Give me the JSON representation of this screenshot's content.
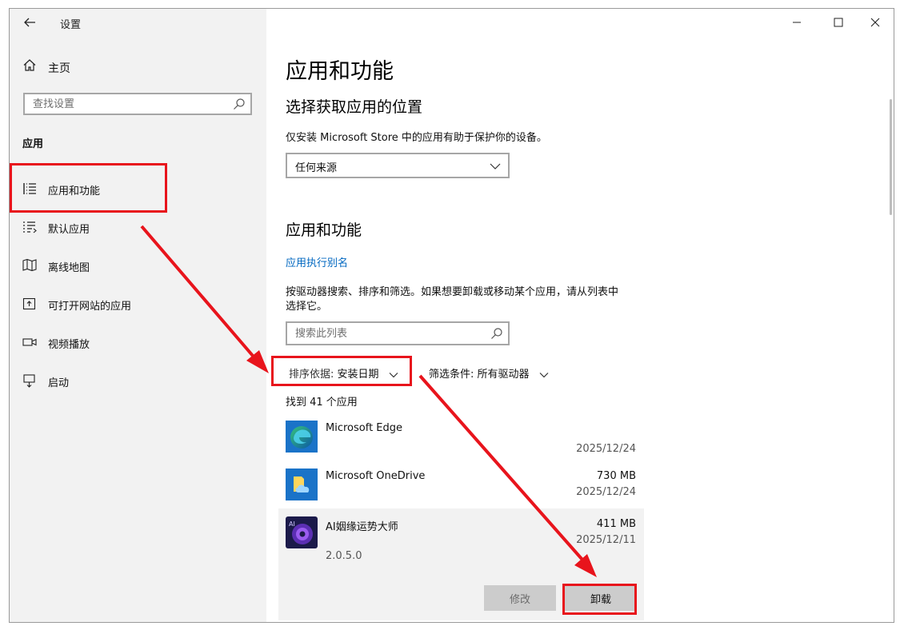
{
  "window": {
    "title": "设置",
    "back_icon": "back-arrow-icon",
    "controls": [
      "minimize-icon",
      "maximize-icon",
      "close-icon"
    ]
  },
  "sidebar": {
    "home_label": "主页",
    "search_placeholder": "查找设置",
    "section_title": "应用",
    "items": [
      {
        "label": "应用和功能",
        "icon": "apps-list-icon",
        "selected": true
      },
      {
        "label": "默认应用",
        "icon": "default-apps-icon"
      },
      {
        "label": "离线地图",
        "icon": "map-icon"
      },
      {
        "label": "可打开网站的应用",
        "icon": "open-website-icon"
      },
      {
        "label": "视频播放",
        "icon": "video-icon"
      },
      {
        "label": "启动",
        "icon": "startup-icon"
      }
    ]
  },
  "main": {
    "page_title": "应用和功能",
    "source_heading": "选择获取应用的位置",
    "source_desc": "仅安装 Microsoft Store 中的应用有助于保护你的设备。",
    "source_value": "任何来源",
    "apps_heading": "应用和功能",
    "alias_link": "应用执行别名",
    "search_desc_line1": "按驱动器搜索、排序和筛选。如果想要卸载或移动某个应用，请从列表中",
    "search_desc_line2": "选择它。",
    "list_search_placeholder": "搜索此列表",
    "sort_key": "排序依据:",
    "sort_value": "安装日期",
    "filter_key": "筛选条件:",
    "filter_value": "所有驱动器",
    "count_text": "找到 41 个应用",
    "apps": [
      {
        "name": "Microsoft Edge",
        "size": "",
        "date": "2025/12/24",
        "icon": "edge-icon"
      },
      {
        "name": "Microsoft OneDrive",
        "size": "730 MB",
        "date": "2025/12/24",
        "icon": "onedrive-icon"
      },
      {
        "name": "AI姻缘运势大师",
        "size": "411 MB",
        "date": "2025/12/11",
        "version": "2.0.5.0",
        "icon": "ai-app-icon",
        "expanded": true
      }
    ],
    "modify_label": "修改",
    "uninstall_label": "卸载"
  },
  "colors": {
    "accent": "#0067c0",
    "annotation_red": "#e8141c",
    "sidebar_bg": "#f2f2f2"
  }
}
